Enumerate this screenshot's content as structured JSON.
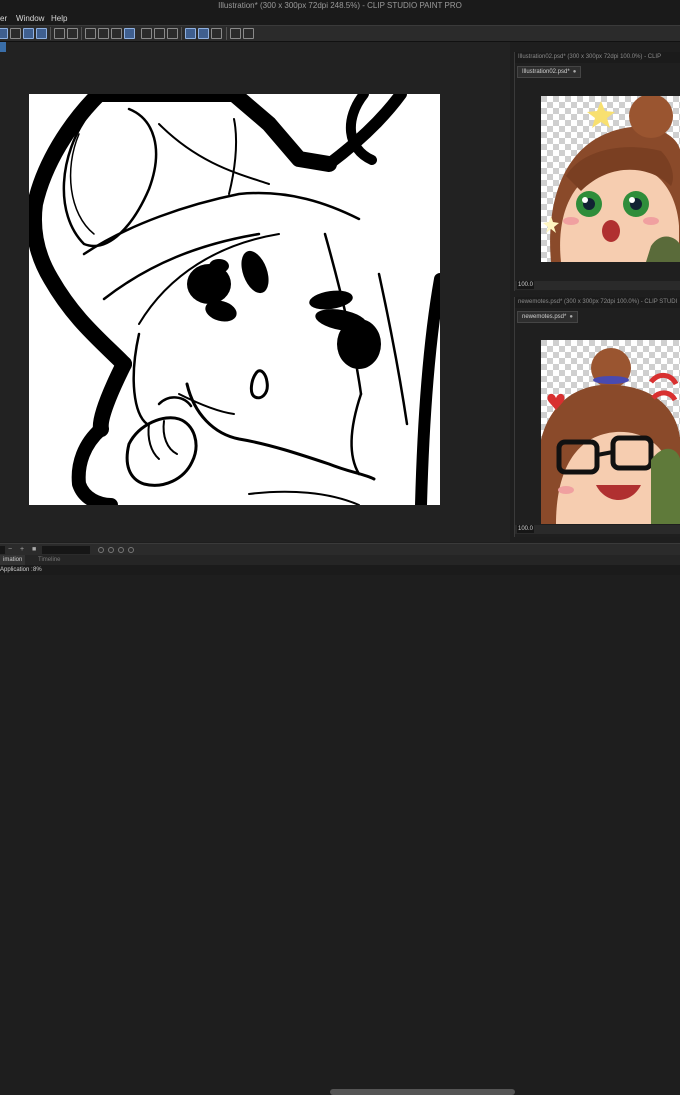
{
  "window": {
    "title": "Illustration* (300 x 300px 72dpi 248.5%)  - CLIP STUDIO PAINT PRO"
  },
  "menu": [
    "er",
    "Window",
    "Help"
  ],
  "sub_windows": [
    {
      "title": "Illustration02.psd* (300 x 300px 72dpi 100.0%)  - CLIP",
      "tab": "Illustration02.psd*",
      "zoom": "100.0"
    },
    {
      "title": "newemotes.psd* (300 x 300px 72dpi 100.0%)  - CLIP STUDI",
      "tab": "newemotes.psd*",
      "zoom": "100.0"
    }
  ],
  "status": {
    "zoom": "100.0"
  },
  "bottom_tabs": [
    "imation",
    "Timeline"
  ],
  "footer": {
    "label": "Application :",
    "value": "8%"
  },
  "colors": {
    "accent": "#3f5f8f",
    "canvas_bg": "#222222"
  }
}
